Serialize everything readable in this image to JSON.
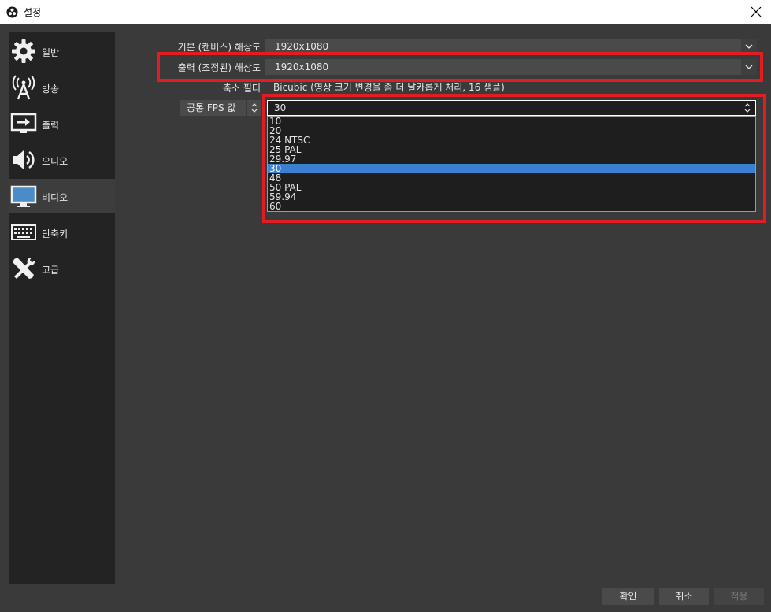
{
  "window": {
    "title": "설정"
  },
  "sidebar": {
    "items": [
      {
        "label": "일반",
        "icon": "gear-icon"
      },
      {
        "label": "방송",
        "icon": "broadcast-antenna-icon"
      },
      {
        "label": "출력",
        "icon": "output-monitor-icon"
      },
      {
        "label": "오디오",
        "icon": "speaker-icon"
      },
      {
        "label": "비디오",
        "icon": "monitor-icon",
        "active": true
      },
      {
        "label": "단축키",
        "icon": "keyboard-icon"
      },
      {
        "label": "고급",
        "icon": "tools-icon"
      }
    ]
  },
  "video": {
    "base_resolution": {
      "label": "기본 (캔버스) 해상도",
      "value": "1920x1080"
    },
    "output_resolution": {
      "label": "출력 (조정된) 해상도",
      "value": "1920x1080"
    },
    "downscale_filter": {
      "label": "축소 필터",
      "value": "Bicubic (영상 크기 변경을 좀 더 날카롭게 처리, 16 샘플)"
    },
    "fps_type": {
      "value": "공통 FPS 값"
    },
    "fps_value": {
      "value": "30",
      "options": [
        "10",
        "20",
        "24 NTSC",
        "25 PAL",
        "29.97",
        "30",
        "48",
        "50 PAL",
        "59.94",
        "60"
      ],
      "selected_index": 5
    }
  },
  "buttons": {
    "ok": "확인",
    "cancel": "취소",
    "apply": "적용"
  },
  "colors": {
    "highlight": "#e11d23",
    "selection": "#3b7fd1",
    "sidebar_bg": "#232323",
    "panel_bg": "#3a3a3a"
  }
}
